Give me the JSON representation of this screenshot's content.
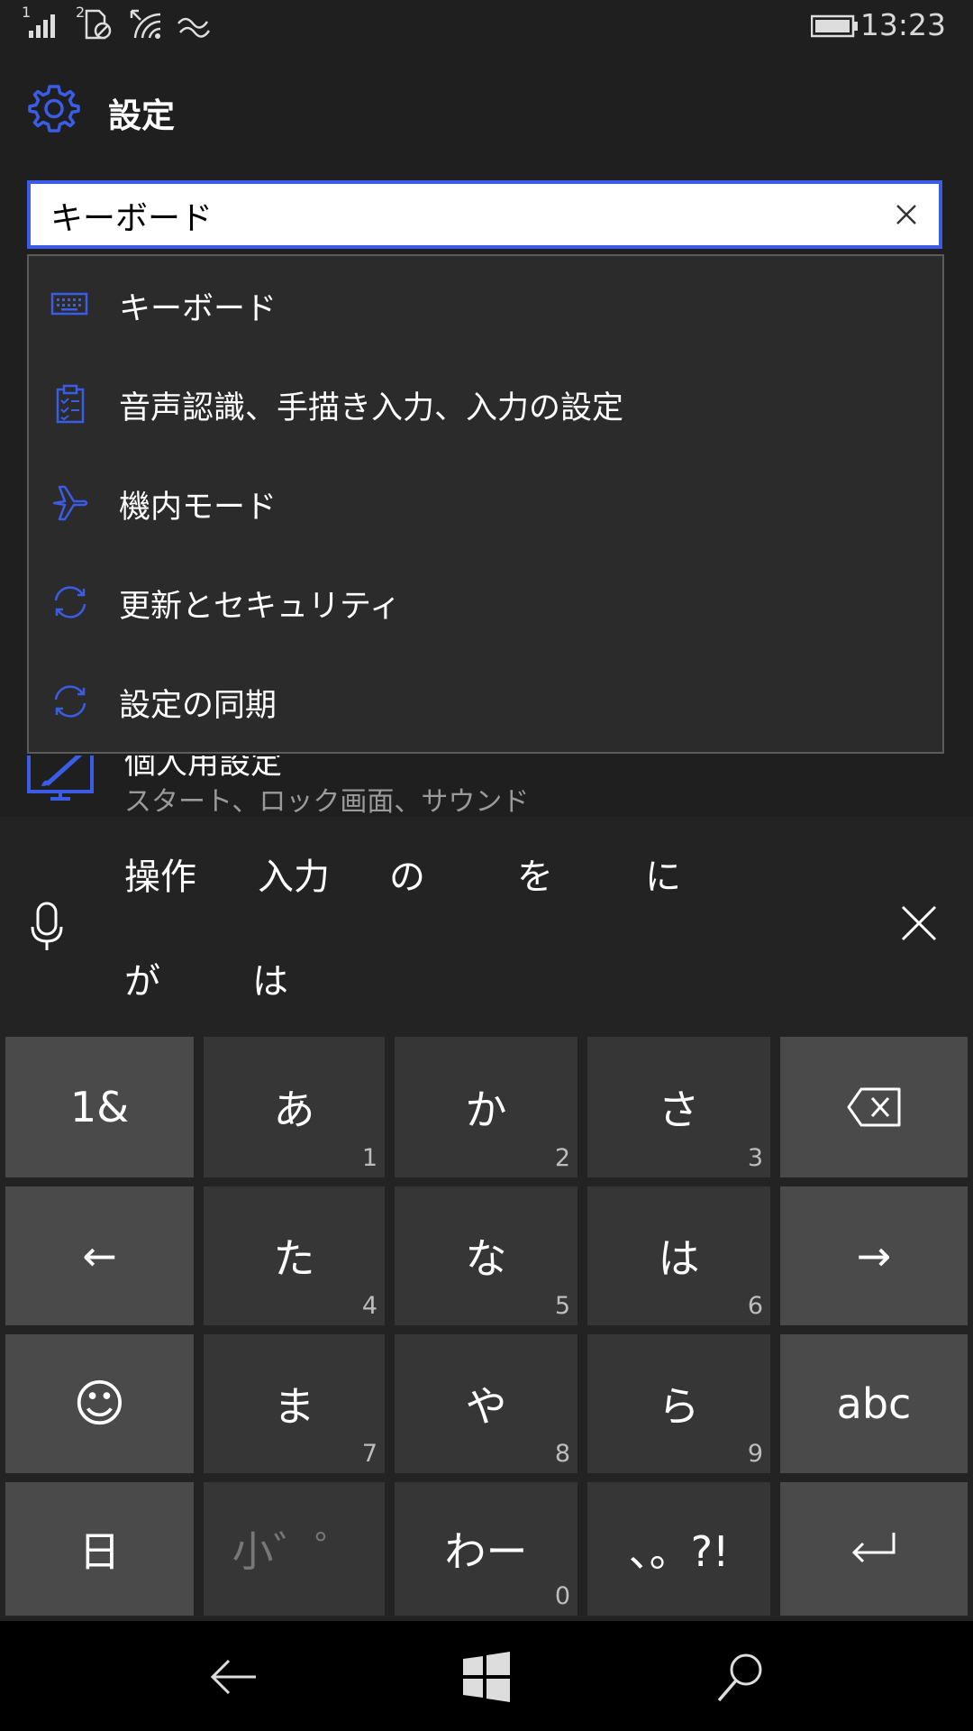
{
  "status_bar": {
    "sim1": "1",
    "sim2": "2",
    "time": "13:23"
  },
  "header": {
    "title": "設定"
  },
  "search": {
    "value": "キーボード"
  },
  "suggestions": [
    {
      "icon": "keyboard-icon",
      "label": "キーボード"
    },
    {
      "icon": "clipboard-icon",
      "label": "音声認識、手描き入力、入力の設定"
    },
    {
      "icon": "airplane-icon",
      "label": "機内モード"
    },
    {
      "icon": "sync-icon",
      "label": "更新とセキュリティ"
    },
    {
      "icon": "sync-icon",
      "label": "設定の同期"
    }
  ],
  "background_item": {
    "title": "個人用設定",
    "subtitle": "スタート、ロック画面、サウンド"
  },
  "candidates": {
    "row1": [
      "操作",
      "入力",
      "の",
      "を",
      "に"
    ],
    "row2": [
      "が",
      "は"
    ]
  },
  "keyboard": {
    "rows": [
      [
        {
          "label": "1&",
          "num": ""
        },
        {
          "label": "あ",
          "num": "1"
        },
        {
          "label": "か",
          "num": "2"
        },
        {
          "label": "さ",
          "num": "3"
        },
        {
          "label": "",
          "num": "",
          "icon": "backspace-icon"
        }
      ],
      [
        {
          "label": "←",
          "num": ""
        },
        {
          "label": "た",
          "num": "4"
        },
        {
          "label": "な",
          "num": "5"
        },
        {
          "label": "は",
          "num": "6"
        },
        {
          "label": "→",
          "num": ""
        }
      ],
      [
        {
          "label": "☺",
          "num": "",
          "icon": "emoji-icon"
        },
        {
          "label": "ま",
          "num": "7"
        },
        {
          "label": "や",
          "num": "8"
        },
        {
          "label": "ら",
          "num": "9"
        },
        {
          "label": "abc",
          "num": ""
        }
      ],
      [
        {
          "label": "日",
          "num": ""
        },
        {
          "label": "小゛゜",
          "num": ""
        },
        {
          "label": "わー",
          "num": "0"
        },
        {
          "label": "、。?!",
          "num": ""
        },
        {
          "label": "↵",
          "num": "",
          "icon": "enter-icon"
        }
      ]
    ]
  },
  "colors": {
    "accent": "#3b5ce6",
    "background": "#1f1f1f",
    "key_dark": "#363636",
    "key_light": "#4a4a4a"
  }
}
